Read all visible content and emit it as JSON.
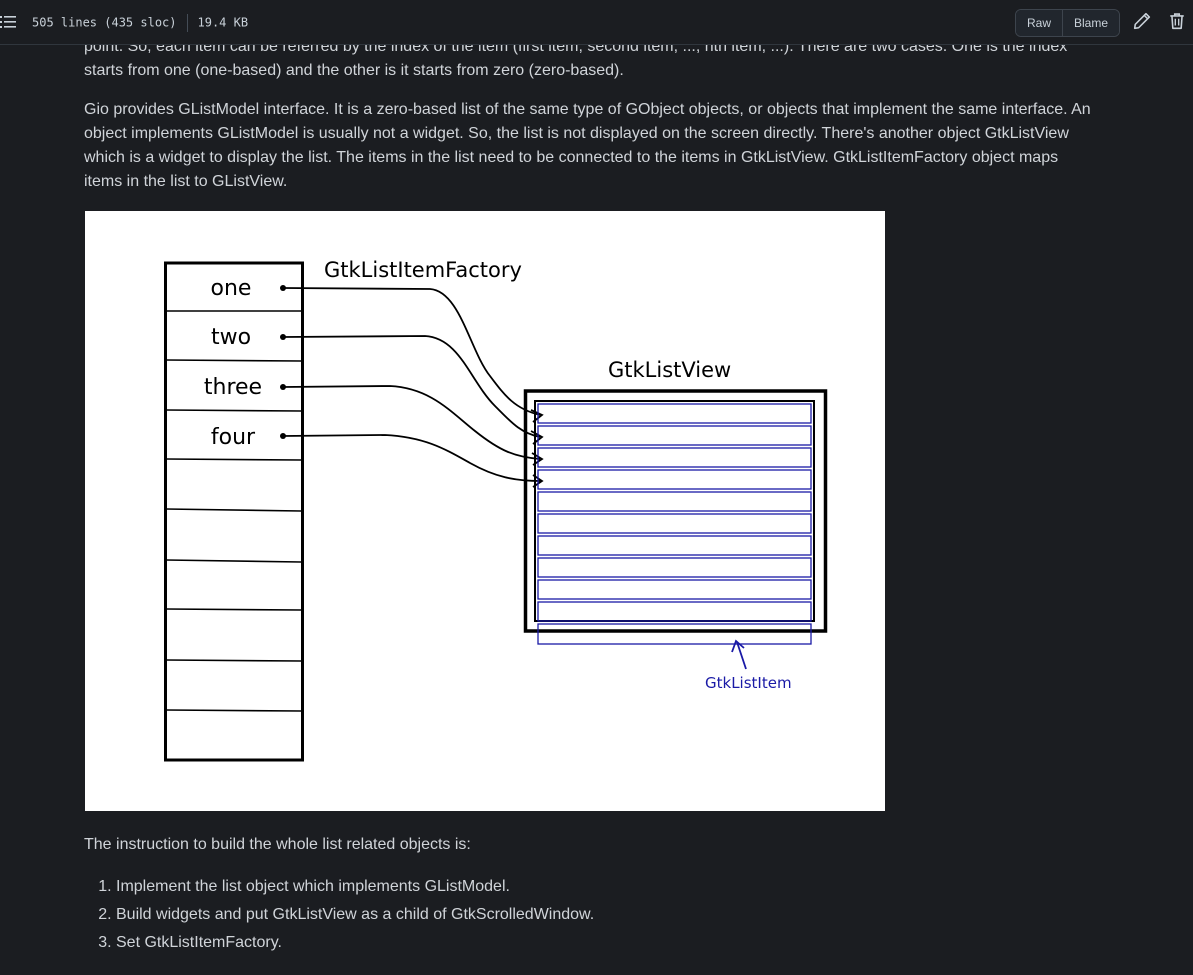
{
  "file_header": {
    "lines": "505 lines (435 sloc)",
    "size": "19.4 KB",
    "raw_label": "Raw",
    "blame_label": "Blame",
    "icons": [
      "list-icon",
      "pencil-icon",
      "trash-icon"
    ]
  },
  "article": {
    "partial_paragraph": "point. So, each item can be referred by the index of the item (first item, second item, ..., nth item, ...). There are two cases. One is the index starts from one (one-based) and the other is it starts from zero (zero-based).",
    "paragraph_glistmodel": "Gio provides GListModel interface. It is a zero-based list of the same type of GObject objects, or objects that implement the same interface. An object implements GListModel is usually not a widget. So, the list is not displayed on the screen directly. There's another object GtkListView which is a widget to display the list. The items in the list need to be connected to the items in GtkListView. GtkListItemFactory object maps items in the list to GListView.",
    "instruction_intro": "The instruction to build the whole list related objects is:",
    "steps": [
      "Implement the list object which implements GListModel.",
      "Build widgets and put GtkListView as a child of GtkScrolledWindow.",
      "Set GtkListItemFactory."
    ]
  },
  "diagram": {
    "list_items": [
      "one",
      "two",
      "three",
      "four"
    ],
    "factory_label": "GtkListItemFactory",
    "listview_label": "GtkListView",
    "listitem_label": "GtkListItem",
    "colors": {
      "ink": "#000000",
      "listitem_blue": "#1a1aa6",
      "background": "#ffffff"
    }
  }
}
